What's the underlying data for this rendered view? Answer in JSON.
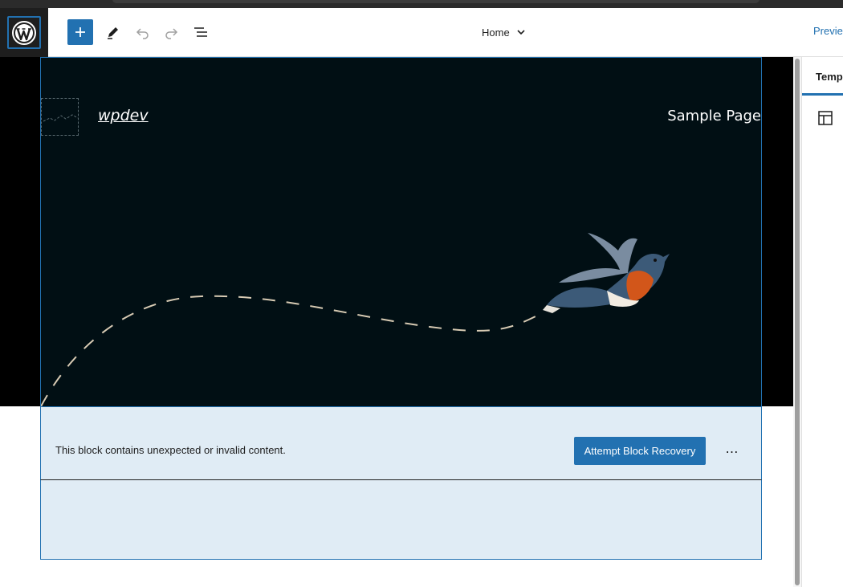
{
  "topbar": {
    "logo_icon": "wordpress-logo-icon",
    "add_icon": "plus-icon",
    "edit_icon": "pencil-icon",
    "undo_icon": "undo-icon",
    "redo_icon": "redo-icon",
    "listview_icon": "list-view-icon",
    "document_title": "Home",
    "document_title_icon": "chevron-down-icon",
    "preview_label": "Previe"
  },
  "site": {
    "title": "wpdev",
    "nav_item": "Sample Page"
  },
  "block_warning": {
    "message": "This block contains unexpected or invalid content.",
    "recovery_label": "Attempt Block Recovery",
    "more_icon": "more-options-icon",
    "more_label": "⋯"
  },
  "sidebar": {
    "tab_label": "Temp",
    "template_icon": "template-layout-icon"
  },
  "colors": {
    "accent": "#2271b1",
    "cover_bg": "#010f14",
    "warning_bg": "#e0ecf5"
  }
}
